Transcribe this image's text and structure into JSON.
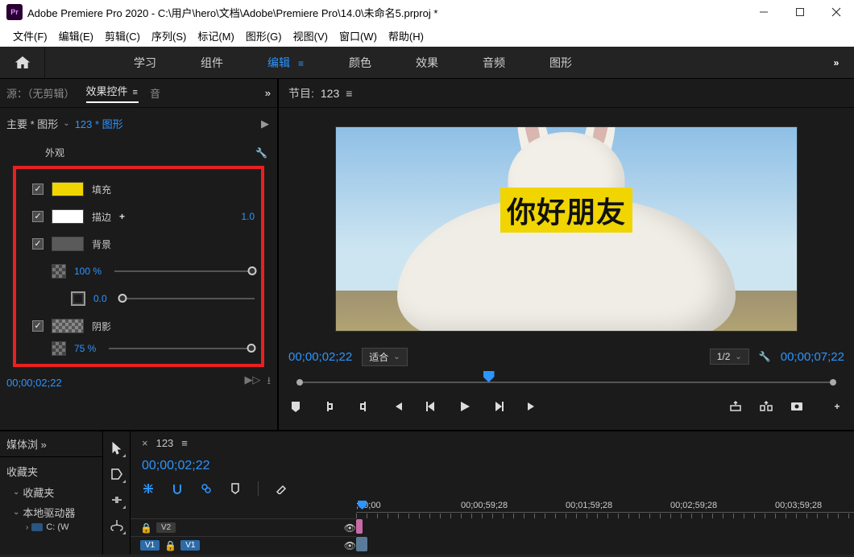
{
  "titlebar": {
    "app_icon_text": "Pr",
    "title": "Adobe Premiere Pro 2020 - C:\\用户\\hero\\文档\\Adobe\\Premiere Pro\\14.0\\未命名5.prproj *"
  },
  "menubar": {
    "items": [
      "文件(F)",
      "编辑(E)",
      "剪辑(C)",
      "序列(S)",
      "标记(M)",
      "图形(G)",
      "视图(V)",
      "窗口(W)",
      "帮助(H)"
    ]
  },
  "workspaces": {
    "tabs": [
      "学习",
      "组件",
      "编辑",
      "颜色",
      "效果",
      "音频",
      "图形"
    ],
    "active_index": 2,
    "overflow": "»"
  },
  "source_panel": {
    "tabs": [
      "源：（无剪辑）",
      "效果控件",
      "音"
    ],
    "active_index": 1,
    "overflow": "»",
    "clip_path_left": "主要 * 图形",
    "clip_path_seq": "123 * 图形",
    "appearance_label": "外观",
    "properties": {
      "p0": {
        "label": "填充",
        "color": "#f0d500"
      },
      "p1": {
        "label": "描边",
        "color": "#ffffff",
        "value": "1.0"
      },
      "p2": {
        "label": "背景",
        "color": "#5a5a5a"
      },
      "opacity": {
        "value": "100 %"
      },
      "border": {
        "value": "0.0"
      },
      "p3": {
        "label": "阴影"
      },
      "shadow_opacity": {
        "value": "75 %"
      }
    },
    "timecode": "00;00;02;22"
  },
  "program_panel": {
    "tab_prefix": "节目:",
    "tab_name": "123",
    "title_text": "你好朋友",
    "timecode_left": "00;00;02;22",
    "fit_label": "适合",
    "zoom_label": "1/2",
    "timecode_right": "00;00;07;22"
  },
  "media_browser": {
    "tab": "媒体浏",
    "favorites_heading": "收藏夹",
    "tree": {
      "item0": "收藏夹",
      "item1": "本地驱动器",
      "drive0": "C: (W"
    }
  },
  "timeline": {
    "seq_name": "123",
    "timecode": "00;00;02;22",
    "ruler_labels": [
      ";00;00",
      "00;00;59;28",
      "00;01;59;28",
      "00;02;59;28",
      "00;03;59;28"
    ],
    "tracks": {
      "v2": {
        "label": "V2"
      },
      "v1": {
        "label_left": "V1",
        "label_chip": "V1"
      }
    }
  }
}
